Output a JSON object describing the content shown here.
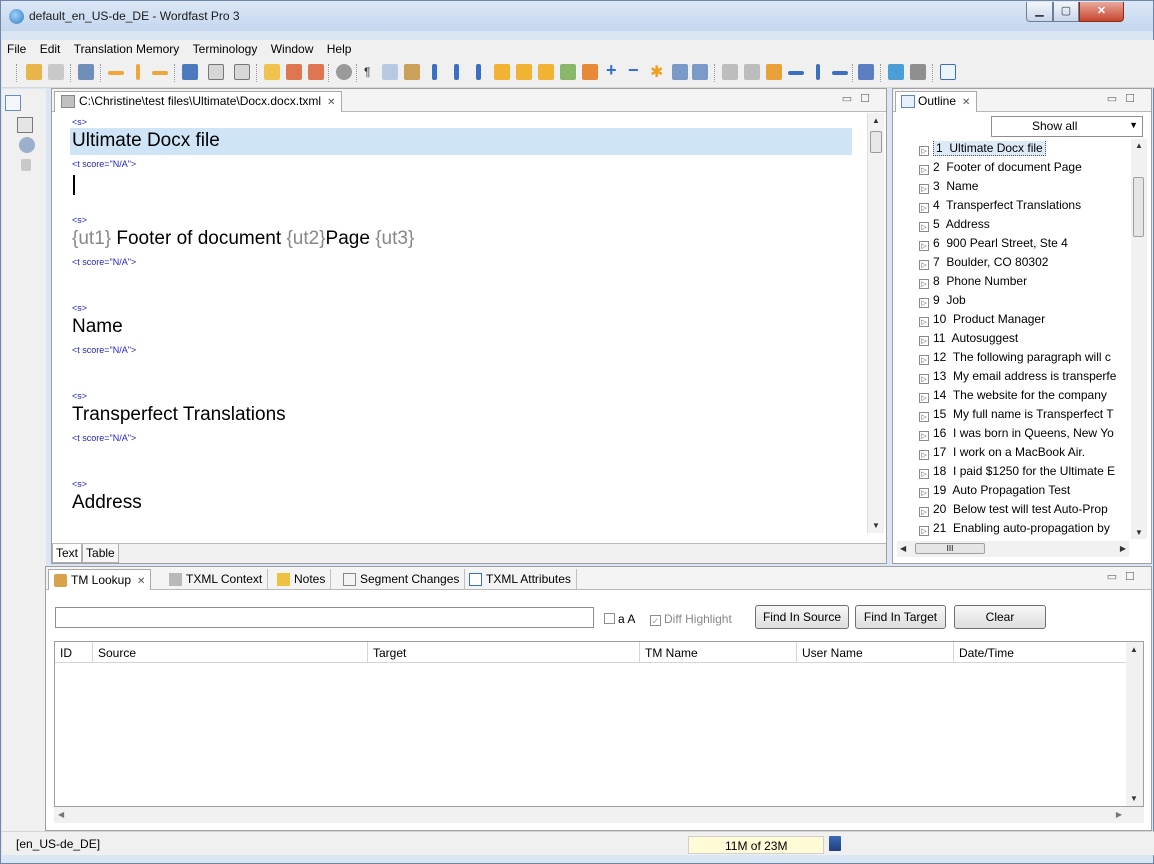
{
  "window": {
    "title": "default_en_US-de_DE - Wordfast Pro 3"
  },
  "menu": [
    "File",
    "Edit",
    "Translation Memory",
    "Terminology",
    "Window",
    "Help"
  ],
  "editor": {
    "tab_title": "C:\\Christine\\test files\\Ultimate\\Docx.docx.txml",
    "segments": [
      {
        "source_tag": "<s>",
        "source": "Ultimate Docx file",
        "target_tag": "<t score=\"N/A\">"
      },
      {
        "source_tag": "<s>",
        "ut1": "{ut1}",
        "source_a": " Footer of document ",
        "ut2": "{ut2}",
        "source_b": "Page ",
        "ut3": "{ut3}",
        "target_tag": "<t score=\"N/A\">"
      },
      {
        "source_tag": "<s>",
        "source": "Name",
        "target_tag": "<t score=\"N/A\">"
      },
      {
        "source_tag": "<s>",
        "source": "Transperfect Translations",
        "target_tag": "<t score=\"N/A\">"
      },
      {
        "source_tag": "<s>",
        "source": "Address"
      }
    ],
    "bottom_tabs": [
      "Text",
      "Table"
    ]
  },
  "outline": {
    "tab_title": "Outline",
    "filter": "Show all",
    "items": [
      {
        "n": "1",
        "label": "Ultimate Docx file"
      },
      {
        "n": "2",
        "label": "Footer of document Page"
      },
      {
        "n": "3",
        "label": "Name"
      },
      {
        "n": "4",
        "label": "Transperfect Translations"
      },
      {
        "n": "5",
        "label": "Address"
      },
      {
        "n": "6",
        "label": "900 Pearl Street, Ste 4"
      },
      {
        "n": "7",
        "label": "Boulder, CO 80302"
      },
      {
        "n": "8",
        "label": "Phone Number"
      },
      {
        "n": "9",
        "label": "Job"
      },
      {
        "n": "10",
        "label": "Product Manager"
      },
      {
        "n": "11",
        "label": "Autosuggest"
      },
      {
        "n": "12",
        "label": "The following paragraph will c"
      },
      {
        "n": "13",
        "label": "My email address is transperfe"
      },
      {
        "n": "14",
        "label": "The website for the company"
      },
      {
        "n": "15",
        "label": "My full name is Transperfect T"
      },
      {
        "n": "16",
        "label": "I was born in Queens, New Yo"
      },
      {
        "n": "17",
        "label": "I work on a MacBook Air."
      },
      {
        "n": "18",
        "label": "I paid $1250 for the Ultimate E"
      },
      {
        "n": "19",
        "label": "Auto Propagation Test"
      },
      {
        "n": "20",
        "label": "Below test will test Auto-Prop"
      },
      {
        "n": "21",
        "label": "Enabling auto-propagation by"
      }
    ]
  },
  "tm_panel": {
    "tabs": [
      "TM Lookup",
      "TXML Context",
      "Notes",
      "Segment Changes",
      "TXML Attributes"
    ],
    "search_value": "",
    "match_case_label": "a A",
    "diff_highlight_label": "Diff Highlight",
    "buttons": {
      "find_source": "Find In Source",
      "find_target": "Find In Target",
      "clear": "Clear"
    },
    "columns": [
      "ID",
      "Source",
      "Target",
      "TM Name",
      "User Name",
      "Date/Time"
    ]
  },
  "status": {
    "locale": "[en_US-de_DE]",
    "memory": "11M of 23M"
  }
}
